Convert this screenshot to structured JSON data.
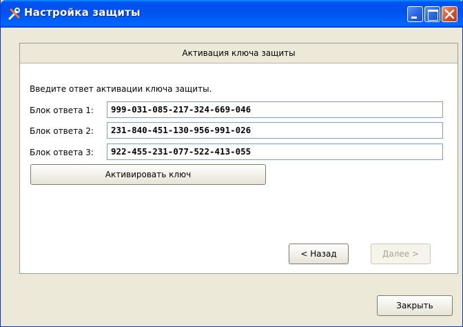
{
  "window": {
    "title": "Настройка защиты"
  },
  "panel": {
    "header": "Активация ключа защиты",
    "prompt": "Введите ответ активации ключа защиты.",
    "rows": [
      {
        "label": "Блок ответа 1:",
        "value": "999-031-085-217-324-669-046"
      },
      {
        "label": "Блок ответа 2:",
        "value": "231-840-451-130-956-991-026"
      },
      {
        "label": "Блок ответа 3:",
        "value": "922-455-231-077-522-413-055"
      }
    ],
    "activate_label": "Активировать ключ",
    "back_label": "< Назад",
    "next_label": "Далее >"
  },
  "footer": {
    "close_label": "Закрыть"
  }
}
